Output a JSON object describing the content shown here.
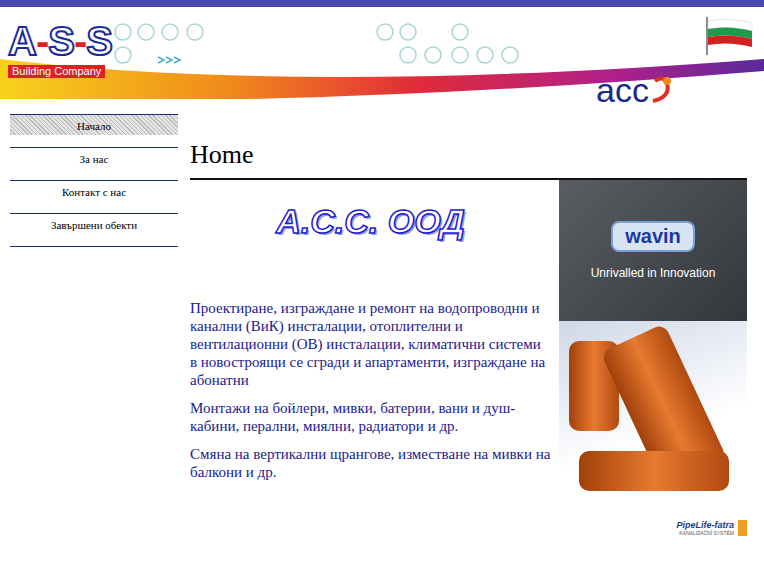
{
  "header": {
    "logo": {
      "text": "A-S-S",
      "tagline": "Building Company"
    },
    "partner_logo": "acc"
  },
  "sidebar": {
    "items": [
      {
        "label": "Начало",
        "selected": true
      },
      {
        "label": "За нас",
        "selected": false
      },
      {
        "label": "Контакт с нас",
        "selected": false
      },
      {
        "label": "Завършени обекти",
        "selected": false
      }
    ]
  },
  "page": {
    "heading": "Home",
    "company": "А.С.С. ООД",
    "paragraphs": [
      "Проектиране, изграждане и ремонт на водопроводни и канални (ВиК) инсталации, отоплителни и вентилационни (ОВ) инсталации, климатични  системи в новостроящи се сгради и апартаменти, изграждане на абонатни",
      "Монтажи на бойлери, мивки, батерии, вани и душ-кабини, перални, миялни, радиатори и др.",
      "Смяна на вертикални щрангове, изместване на мивки на балкони и др."
    ]
  },
  "ad": {
    "brand": "wavin",
    "slogan": "Unrivalled in Innovation"
  },
  "footer_logo": {
    "brand": "PipeLife-fatra",
    "caption": "KANALIZAČNÍ SYSTÉM"
  }
}
